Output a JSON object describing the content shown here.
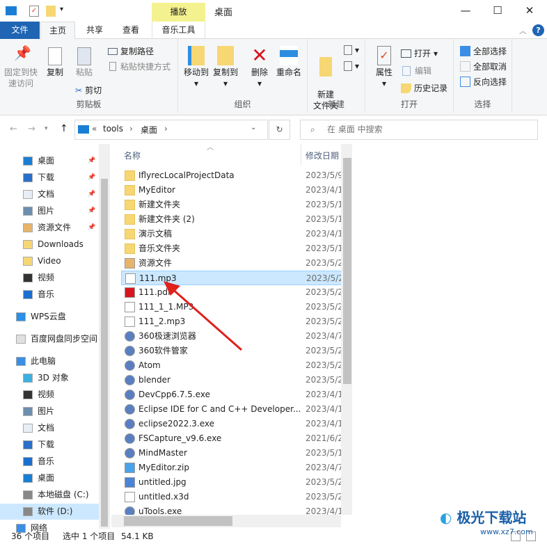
{
  "window": {
    "title": "桌面",
    "context_tab": "播放",
    "controls": [
      "—",
      "☐",
      "✕"
    ]
  },
  "tabs": {
    "file": "文件",
    "home": "主页",
    "share": "共享",
    "view": "查看",
    "music_tools": "音乐工具"
  },
  "ribbon": {
    "clipboard": {
      "label": "剪贴板",
      "pin": "固定到快速访问",
      "copy": "复制",
      "paste": "粘贴",
      "cut": "剪切",
      "copy_path": "复制路径",
      "paste_shortcut": "粘贴快捷方式"
    },
    "organize": {
      "label": "组织",
      "move_to": "移动到",
      "copy_to": "复制到",
      "delete": "删除",
      "rename": "重命名"
    },
    "new": {
      "label": "新建",
      "new_folder": "新建\n文件夹"
    },
    "open": {
      "label": "打开",
      "properties": "属性",
      "open": "打开",
      "edit": "编辑",
      "history": "历史记录"
    },
    "select": {
      "label": "选择",
      "select_all": "全部选择",
      "select_none": "全部取消",
      "invert": "反向选择"
    }
  },
  "address": {
    "prefix": "«",
    "path": [
      "tools",
      "桌面"
    ],
    "search_placeholder": "在 桌面 中搜索"
  },
  "nav": [
    {
      "label": "桌面",
      "icon": "desktop",
      "pinned": true
    },
    {
      "label": "下载",
      "icon": "download",
      "pinned": true
    },
    {
      "label": "文档",
      "icon": "document",
      "pinned": true
    },
    {
      "label": "图片",
      "icon": "picture",
      "pinned": true
    },
    {
      "label": "资源文件",
      "icon": "folder-res",
      "pinned": true
    },
    {
      "label": "Downloads",
      "icon": "folder"
    },
    {
      "label": "Video",
      "icon": "folder"
    },
    {
      "label": "视频",
      "icon": "video"
    },
    {
      "label": "音乐",
      "icon": "music"
    },
    {
      "label": "WPS云盘",
      "icon": "cloud"
    },
    {
      "label": "百度网盘同步空间",
      "icon": "baidu"
    },
    {
      "label": "此电脑",
      "icon": "pc"
    },
    {
      "label": "3D 对象",
      "icon": "3d"
    },
    {
      "label": "视频",
      "icon": "video"
    },
    {
      "label": "图片",
      "icon": "picture"
    },
    {
      "label": "文档",
      "icon": "document"
    },
    {
      "label": "下载",
      "icon": "download"
    },
    {
      "label": "音乐",
      "icon": "music"
    },
    {
      "label": "桌面",
      "icon": "desktop"
    },
    {
      "label": "本地磁盘 (C:)",
      "icon": "drive"
    },
    {
      "label": "软件 (D:)",
      "icon": "drive",
      "selected": true
    },
    {
      "label": "网络",
      "icon": "network"
    }
  ],
  "columns": {
    "name": "名称",
    "date": "修改日期"
  },
  "files": [
    {
      "name": "IflyrecLocalProjectData",
      "date": "2023/5/9",
      "icon": "folder"
    },
    {
      "name": "MyEditor",
      "date": "2023/4/1",
      "icon": "folder"
    },
    {
      "name": "新建文件夹",
      "date": "2023/5/1",
      "icon": "folder"
    },
    {
      "name": "新建文件夹 (2)",
      "date": "2023/5/1",
      "icon": "folder"
    },
    {
      "name": "演示文稿",
      "date": "2023/4/1",
      "icon": "folder"
    },
    {
      "name": "音乐文件夹",
      "date": "2023/5/1",
      "icon": "folder"
    },
    {
      "name": "资源文件",
      "date": "2023/5/2",
      "icon": "folder-res"
    },
    {
      "name": "111.mp3",
      "date": "2023/5/2",
      "icon": "file",
      "selected": true
    },
    {
      "name": "111.pdf",
      "date": "2023/5/2",
      "icon": "pdf"
    },
    {
      "name": "111_1_1.MP3",
      "date": "2023/5/2",
      "icon": "file"
    },
    {
      "name": "111_2.mp3",
      "date": "2023/5/2",
      "icon": "file"
    },
    {
      "name": "360极速浏览器",
      "date": "2023/4/7",
      "icon": "app"
    },
    {
      "name": "360软件管家",
      "date": "2023/5/2",
      "icon": "app"
    },
    {
      "name": "Atom",
      "date": "2023/5/2",
      "icon": "app"
    },
    {
      "name": "blender",
      "date": "2023/5/2",
      "icon": "app"
    },
    {
      "name": "DevCpp6.7.5.exe",
      "date": "2023/4/1",
      "icon": "app"
    },
    {
      "name": "Eclipse IDE for C and C++ Developer...",
      "date": "2023/4/1",
      "icon": "app"
    },
    {
      "name": "eclipse2022.3.exe",
      "date": "2023/4/1",
      "icon": "app"
    },
    {
      "name": "FSCapture_v9.6.exe",
      "date": "2021/6/2",
      "icon": "app"
    },
    {
      "name": "MindMaster",
      "date": "2023/5/1",
      "icon": "app"
    },
    {
      "name": "MyEditor.zip",
      "date": "2023/4/7",
      "icon": "zip"
    },
    {
      "name": "untitled.jpg",
      "date": "2023/5/2",
      "icon": "jpg"
    },
    {
      "name": "untitled.x3d",
      "date": "2023/5/2",
      "icon": "file"
    },
    {
      "name": "uTools.exe",
      "date": "2023/4/1",
      "icon": "app"
    }
  ],
  "status": {
    "count": "36 个项目",
    "selected": "选中 1 个项目",
    "size": "54.1 KB"
  },
  "watermark": {
    "text": "极光下载站",
    "url": "www.xz7.com"
  },
  "colors": {
    "accent": "#1f65b3",
    "selection": "#cce8ff",
    "arrow": "#e0201b",
    "context_tab": "#f4f28f"
  }
}
